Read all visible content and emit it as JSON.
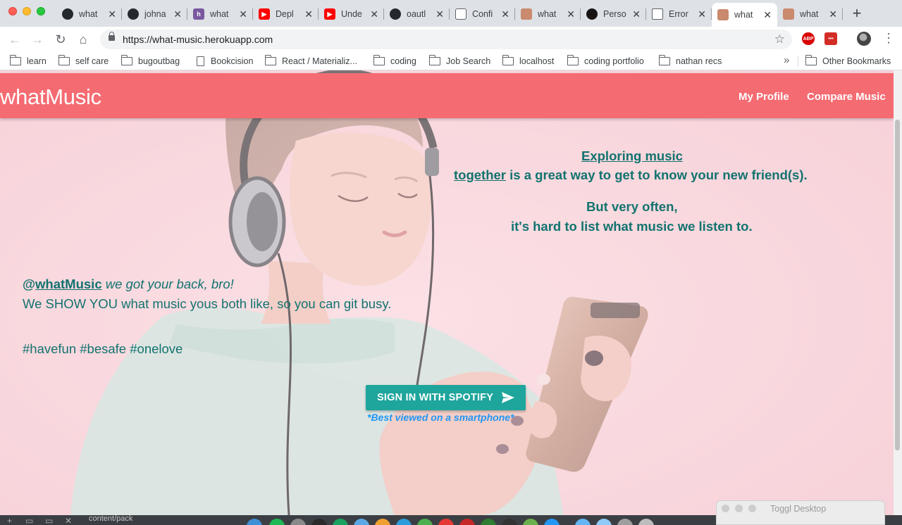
{
  "browser": {
    "tabs": [
      {
        "title": "what",
        "icon": "github-icon",
        "active": false
      },
      {
        "title": "johna",
        "icon": "github-icon",
        "active": false
      },
      {
        "title": "what",
        "icon": "heroku-icon",
        "active": false
      },
      {
        "title": "Depl",
        "icon": "youtube-icon",
        "active": false
      },
      {
        "title": "Unde",
        "icon": "youtube-icon",
        "active": false
      },
      {
        "title": "oautl",
        "icon": "github-icon",
        "active": false
      },
      {
        "title": "Confi",
        "icon": "book-icon",
        "active": false
      },
      {
        "title": "what",
        "icon": "photo-icon",
        "active": false
      },
      {
        "title": "Perso",
        "icon": "spotify-icon",
        "active": false
      },
      {
        "title": "Error",
        "icon": "page-icon",
        "active": false
      },
      {
        "title": "what",
        "icon": "photo-icon",
        "active": true
      },
      {
        "title": "what",
        "icon": "photo-icon",
        "active": false
      }
    ],
    "url": "https://what-music.herokuapp.com",
    "extensions": {
      "abp_label": "ABP",
      "lastpass_label": "•••"
    },
    "bookmarks": [
      {
        "label": "learn",
        "type": "folder"
      },
      {
        "label": "self care",
        "type": "folder"
      },
      {
        "label": "bugoutbag",
        "type": "folder"
      },
      {
        "label": "Bookcision",
        "type": "page"
      },
      {
        "label": "React / Materializ...",
        "type": "folder"
      },
      {
        "label": "coding",
        "type": "folder"
      },
      {
        "label": "Job Search",
        "type": "folder"
      },
      {
        "label": "localhost",
        "type": "folder"
      },
      {
        "label": "coding portfolio",
        "type": "folder"
      },
      {
        "label": "nathan recs",
        "type": "folder"
      }
    ],
    "other_bookmarks": "Other Bookmarks"
  },
  "app": {
    "brand": "whatMusic",
    "nav": {
      "profile": "My Profile",
      "compare": "Compare Music"
    },
    "headline": {
      "link1": "Exploring music",
      "link2": "together",
      "line2_rest": " is a great way to get to know your new friend(s).",
      "line3": "But very often,",
      "line4": "it's hard to list what music we listen to."
    },
    "copy": {
      "at": "@",
      "handle": "whatMusic",
      "tagline": " we got your back, bro!",
      "line2": "We SHOW YOU what music yous both like, so you can git busy.",
      "hashtags": "#havefun #besafe #onelove"
    },
    "cta": {
      "label": "SIGN IN WITH SPOTIFY",
      "icon": "send-icon"
    },
    "note": "*Best viewed on a smartphone*"
  },
  "desktop": {
    "bottom_text": "content/pack",
    "toggl_title": "Toggl Desktop"
  },
  "colors": {
    "nav": "#f56b72",
    "teal_text": "#12736f",
    "cta": "#1ea59c",
    "note": "#2196f3",
    "page_bg": "#f7d3da"
  }
}
